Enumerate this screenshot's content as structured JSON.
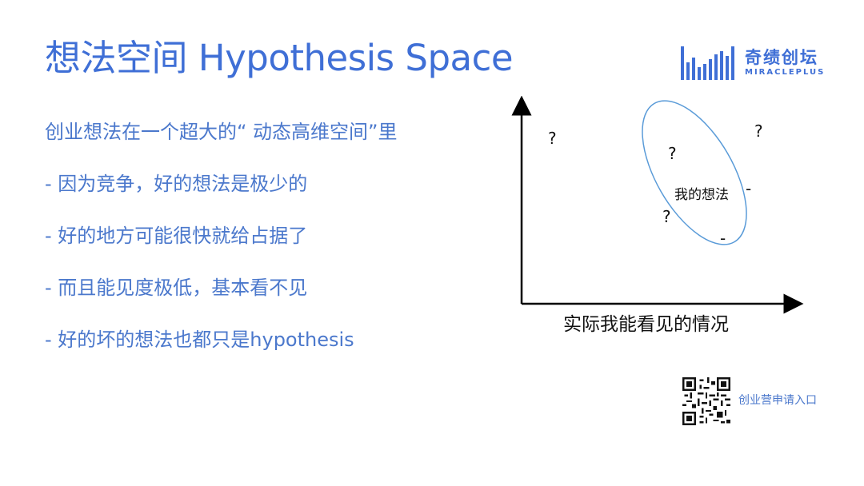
{
  "slide": {
    "title": "想法空间 Hypothesis Space",
    "bullets": [
      "创业想法在一个超大的“ 动态高维空间”里",
      "- 因为竞争，好的想法是极少的",
      "- 好的地方可能很快就给占据了",
      "- 而且能见度极低，基本看不见",
      "- 好的坏的想法也都只是hypothesis"
    ]
  },
  "logo": {
    "name_cn": "奇绩创坛",
    "name_en": "MIRACLEPLUS",
    "icon": "bar-chart-logo-icon",
    "color": "#3f6fd6"
  },
  "diagram": {
    "x_axis_label": "实际我能看见的情况",
    "region_label": "我的想法",
    "marks": [
      "?",
      "?",
      "?",
      "?",
      "-",
      "-"
    ],
    "ellipse_color": "#5a9bd8"
  },
  "footer": {
    "qr_icon": "qr-code-icon",
    "qr_label": "创业营申请入口"
  },
  "colors": {
    "accent": "#3f6fd6",
    "text": "#4b78cc"
  }
}
